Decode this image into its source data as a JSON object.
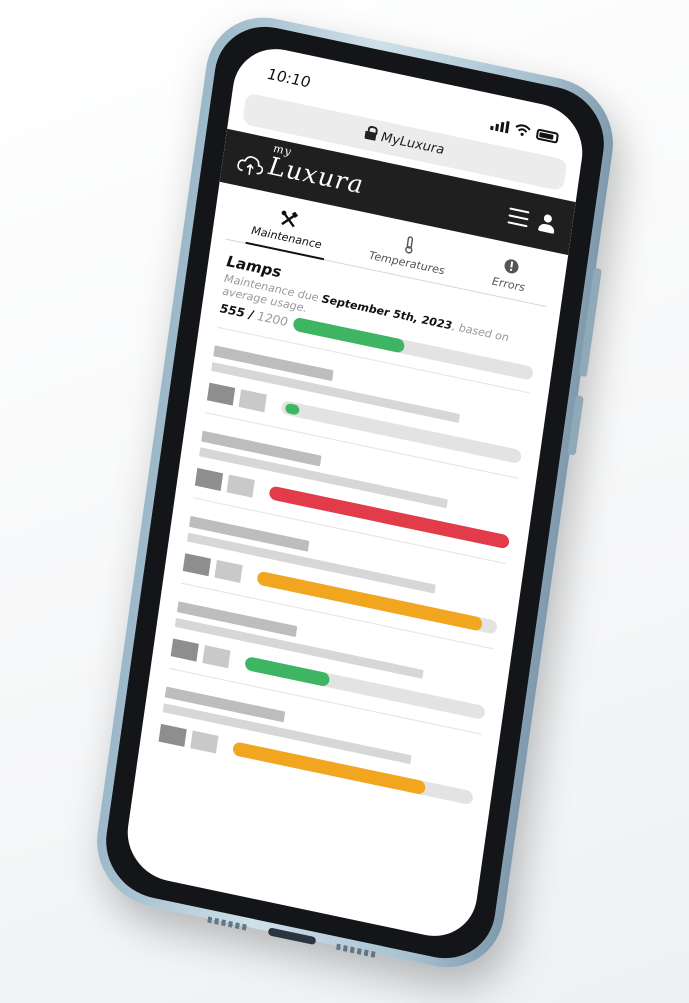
{
  "status_bar": {
    "time": "10:10"
  },
  "browser": {
    "url": "MyLuxura"
  },
  "brand": {
    "prefix": "my",
    "name": "Luxura"
  },
  "tabs": [
    {
      "label": "Maintenance",
      "icon": "tools-icon",
      "active": true
    },
    {
      "label": "Temperatures",
      "icon": "thermometer-icon",
      "active": false
    },
    {
      "label": "Errors",
      "icon": "alert-icon",
      "active": false
    }
  ],
  "lamps": {
    "title": "Lamps",
    "desc_prefix": "Maintenance due ",
    "due_date": "September 5th, 2023",
    "desc_suffix": ", based on average usage.",
    "hours_used": "555",
    "separator": " / ",
    "hours_total": "1200",
    "progress": 0.4625,
    "color": "#3db562"
  },
  "placeholder_items": [
    {
      "progress": 0.04,
      "color": "#3db562"
    },
    {
      "progress": 1.0,
      "color": "#e23b4a"
    },
    {
      "progress": 0.94,
      "color": "#f2a51f"
    },
    {
      "progress": 0.35,
      "color": "#3db562"
    },
    {
      "progress": 0.8,
      "color": "#f2a51f"
    }
  ],
  "colors": {
    "header_bg": "#1f1f1f",
    "track": "#e3e3e3",
    "phone_frame": "#a9c3d2"
  }
}
